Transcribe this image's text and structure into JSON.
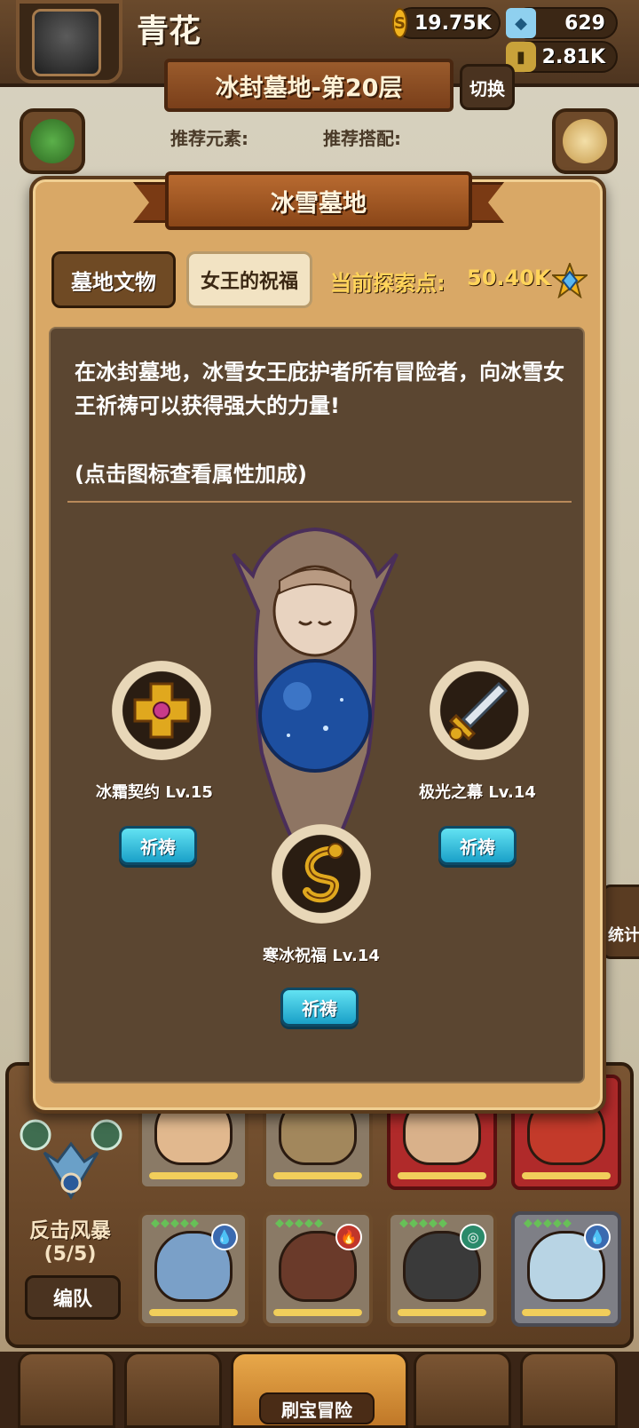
{
  "header": {
    "player_name": "青花",
    "gold": "19.75K",
    "gems": "629",
    "potion": "2.81K"
  },
  "stage": {
    "title": "冰封墓地-第20层",
    "switch_label": "切换",
    "recommended_element_label": "推荐元素:",
    "recommended_combo_label": "推荐搭配:"
  },
  "side": {
    "stats_label": "统计"
  },
  "modal": {
    "title": "冰雪墓地",
    "tabs": [
      {
        "label": "墓地文物",
        "active": false
      },
      {
        "label": "女王的祝福",
        "active": true
      }
    ],
    "explore_label": "当前探索点:",
    "explore_value": "50.40K",
    "description": "在冰封墓地，冰雪女王庇护者所有冒险者，向冰雪女王祈祷可以获得强大的力量!",
    "hint": "(点击图标查看属性加成)",
    "relics": [
      {
        "name": "冰霜契约 Lv.15",
        "pray_label": "祈祷",
        "icon": "golden-cross-icon"
      },
      {
        "name": "极光之幕 Lv.14",
        "pray_label": "祈祷",
        "icon": "sword-icon"
      },
      {
        "name": "寒冰祝福 Lv.14",
        "pray_label": "祈祷",
        "icon": "golden-dragon-icon"
      }
    ]
  },
  "team": {
    "name": "反击风暴",
    "count": "(5/5)",
    "edit_label": "编队"
  },
  "nav": {
    "active_label": "刷宝冒险"
  },
  "colors": {
    "pray_button": "#1aa0c8",
    "explore_text": "#ffd45a",
    "modal_frame": "#d9a866"
  }
}
